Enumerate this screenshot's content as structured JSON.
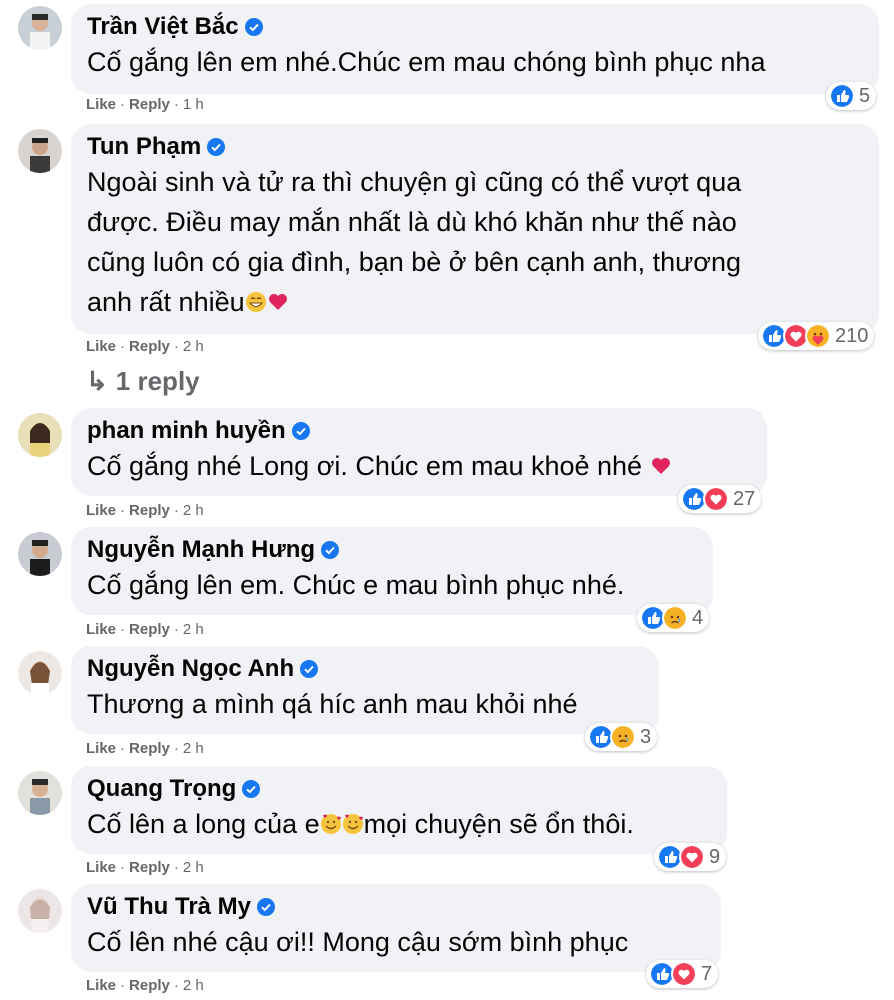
{
  "comments": [
    {
      "author": "Trần Việt Bắc",
      "verified": true,
      "lines": [
        "Cố gắng lên em nhé.Chúc em mau chóng bình phục nha"
      ],
      "like": "Like",
      "reply": "Reply",
      "time": "1 h",
      "reactions": [
        "like"
      ],
      "reaction_count": "5"
    },
    {
      "author": "Tun Phạm",
      "verified": true,
      "lines": [
        "Ngoài sinh và tử ra thì chuyện gì cũng có thể vượt qua",
        "được. Điều may mắn nhất là dù khó khăn như thế nào",
        "cũng luôn có gia đình, bạn bè ở bên cạnh anh, thương",
        "anh rất nhiều"
      ],
      "trailing_emoji": [
        "grin-emoji",
        "heart-emoji"
      ],
      "like": "Like",
      "reply": "Reply",
      "time": "2 h",
      "reactions": [
        "like",
        "love",
        "care"
      ],
      "reaction_count": "210",
      "replies_link": "1 reply"
    },
    {
      "author": "phan minh huyền",
      "verified": true,
      "lines": [
        "Cố gắng nhé Long ơi. Chúc em mau khoẻ nhé"
      ],
      "trailing_emoji": [
        "heart-emoji"
      ],
      "like": "Like",
      "reply": "Reply",
      "time": "2 h",
      "reactions": [
        "like",
        "love"
      ],
      "reaction_count": "27"
    },
    {
      "author": "Nguyễn Mạnh Hưng",
      "verified": true,
      "lines": [
        "Cố gắng lên em. Chúc e mau bình phục nhé."
      ],
      "like": "Like",
      "reply": "Reply",
      "time": "2 h",
      "reactions": [
        "like",
        "sad"
      ],
      "reaction_count": "4"
    },
    {
      "author": "Nguyễn Ngọc Anh",
      "verified": true,
      "lines": [
        "Thương a mình qá híc anh mau khỏi nhé"
      ],
      "like": "Like",
      "reply": "Reply",
      "time": "2 h",
      "reactions": [
        "like",
        "sad"
      ],
      "reaction_count": "3"
    },
    {
      "author": "Quang Trọng",
      "verified": true,
      "lines_parts": [
        "Cố lên a long của e",
        "mọi chuyện sẽ ổn thôi."
      ],
      "inline_emoji": [
        "smiling-hearts-emoji",
        "smiling-hearts-emoji"
      ],
      "like": "Like",
      "reply": "Reply",
      "time": "2 h",
      "reactions": [
        "like",
        "love"
      ],
      "reaction_count": "9"
    },
    {
      "author": "Vũ Thu Trà My",
      "verified": true,
      "lines": [
        "Cố lên nhé cậu ơi!! Mong cậu sớm bình phục"
      ],
      "like": "Like",
      "reply": "Reply",
      "time": "2 h",
      "reactions": [
        "like",
        "love"
      ],
      "reaction_count": "7"
    }
  ],
  "colors": {
    "bubble": "#f0f2f5",
    "text": "#050505",
    "meta": "#65676b",
    "verified": "#1877f2",
    "like": "#1877f2",
    "love": "#f33e58",
    "care_sad": "#f7b125"
  }
}
